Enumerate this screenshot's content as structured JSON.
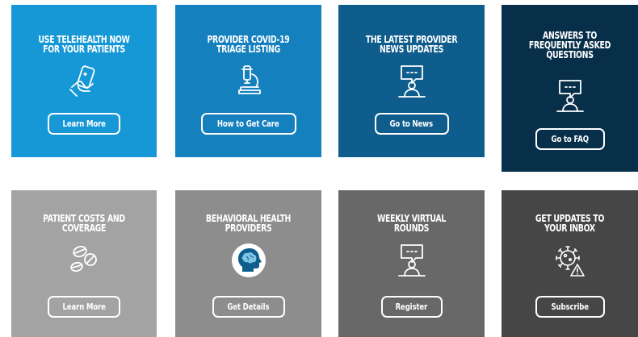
{
  "tiles": [
    {
      "title": "USE TELEHEALTH NOW\nFOR YOUR PATIENTS",
      "button": "Learn More",
      "icon": "hand-holding-phone-icon",
      "color": "#1798d6"
    },
    {
      "title": "PROVIDER COVID-19\nTRIAGE LISTING",
      "button": "How to Get Care",
      "icon": "microscope-icon",
      "color": "#1580be"
    },
    {
      "title": "THE LATEST PROVIDER\nNEWS UPDATES",
      "button": "Go to News",
      "icon": "presenter-speech-bubble-icon",
      "color": "#0f5d8d"
    },
    {
      "title": "ANSWERS TO\nFREQUENTLY ASKED\nQUESTIONS",
      "button": "Go to FAQ",
      "icon": "presenter-speech-bubble-icon",
      "color": "#082f4a"
    },
    {
      "title": "PATIENT COSTS AND\nCOVERAGE",
      "button": "Learn More",
      "icon": "pills-icon",
      "color": "#a3a3a3"
    },
    {
      "title": "BEHAVIORAL HEALTH\nPROVIDERS",
      "button": "Get Details",
      "icon": "head-brain-icon",
      "color": "#8d8d8d"
    },
    {
      "title": "WEEKLY VIRTUAL\nROUNDS",
      "button": "Register",
      "icon": "presenter-speech-bubble-icon",
      "color": "#686868"
    },
    {
      "title": "GET UPDATES TO\nYOUR INBOX",
      "button": "Subscribe",
      "icon": "virus-warning-icon",
      "color": "#464646"
    }
  ]
}
